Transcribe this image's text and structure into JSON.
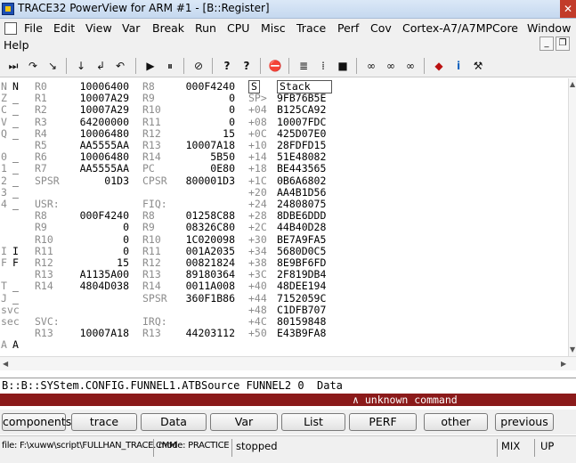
{
  "window": {
    "title": "TRACE32 PowerView for ARM #1 - [B::Register]",
    "close_glyph": "✕"
  },
  "menu": {
    "items": [
      "File",
      "Edit",
      "View",
      "Var",
      "Break",
      "Run",
      "CPU",
      "Misc",
      "Trace",
      "Perf",
      "Cov",
      "Cortex-A7/A7MPCore",
      "Window"
    ],
    "help": "Help",
    "mdi_minimize": "_",
    "mdi_restore": "❐"
  },
  "toolbar": {
    "icons": [
      "step-icon",
      "step-over-icon",
      "step-into-icon",
      "down-arrow-icon",
      "check-icon",
      "return-icon",
      "go-icon",
      "break-icon",
      "no-icon",
      "help-icon",
      "help-pointer-icon",
      "stop-icon",
      "list-icon",
      "memory-icon",
      "chip-icon",
      "glasses-icon",
      "glasses-icon-2",
      "glasses-icon-3",
      "target-icon",
      "info-icon",
      "wrench-icon"
    ],
    "glyphs": [
      "⏭",
      "↷",
      "↘",
      "↓",
      "↲",
      "↶",
      "▶",
      "⏸",
      "⊘",
      "?",
      "?",
      "⛔",
      "≣",
      "⁞",
      "■",
      "∞",
      "∞",
      "∞",
      "◆",
      "i",
      "⚒"
    ]
  },
  "registers": {
    "flags": [
      [
        "N",
        "N"
      ],
      [
        "Z",
        "_"
      ],
      [
        "C",
        "_"
      ],
      [
        "V",
        "_"
      ],
      [
        "Q",
        "_"
      ],
      [
        "",
        ""
      ],
      [
        "0",
        "_"
      ],
      [
        "1",
        "_"
      ],
      [
        "2",
        "_"
      ],
      [
        "3",
        "_"
      ],
      [
        "4",
        "_"
      ],
      [
        "",
        ""
      ],
      [
        "",
        ""
      ],
      [
        "",
        ""
      ],
      [
        "I",
        "I"
      ],
      [
        "F",
        "F"
      ],
      [
        "",
        ""
      ],
      [
        "T",
        "_"
      ],
      [
        "J",
        "_"
      ],
      [
        "svc",
        ""
      ],
      [
        "sec",
        ""
      ],
      [
        "",
        ""
      ],
      [
        "A",
        "A"
      ]
    ],
    "col1": [
      [
        "R0",
        "10006400"
      ],
      [
        "R1",
        "10007A29"
      ],
      [
        "R2",
        "10007A29"
      ],
      [
        "R3",
        "64200000"
      ],
      [
        "R4",
        "10006480"
      ],
      [
        "R5",
        "AA5555AA"
      ],
      [
        "R6",
        "10006480"
      ],
      [
        "R7",
        "AA5555AA"
      ],
      [
        "SPSR",
        "01D3"
      ],
      [
        "",
        ""
      ],
      [
        "USR:",
        ""
      ],
      [
        "R8",
        "000F4240"
      ],
      [
        "R9",
        "0"
      ],
      [
        "R10",
        "0"
      ],
      [
        "R11",
        "0"
      ],
      [
        "R12",
        "15"
      ],
      [
        "R13",
        "A1135A00"
      ],
      [
        "R14",
        "4804D038"
      ],
      [
        "",
        ""
      ],
      [
        "",
        ""
      ],
      [
        "SVC:",
        ""
      ],
      [
        "R13",
        "10007A18"
      ]
    ],
    "col2": [
      [
        "R8",
        "000F4240"
      ],
      [
        "R9",
        "0"
      ],
      [
        "R10",
        "0"
      ],
      [
        "R11",
        "0"
      ],
      [
        "R12",
        "15"
      ],
      [
        "R13",
        "10007A18"
      ],
      [
        "R14",
        "5B50"
      ],
      [
        "PC",
        "0E80"
      ],
      [
        "CPSR",
        "800001D3"
      ],
      [
        "",
        ""
      ],
      [
        "FIQ:",
        ""
      ],
      [
        "R8",
        "01258C88"
      ],
      [
        "R9",
        "08326C80"
      ],
      [
        "R10",
        "1C020098"
      ],
      [
        "R11",
        "001A2035"
      ],
      [
        "R12",
        "00821824"
      ],
      [
        "R13",
        "89180364"
      ],
      [
        "R14",
        "0011A008"
      ],
      [
        "SPSR",
        "360F1B86"
      ],
      [
        "",
        ""
      ],
      [
        "IRQ:",
        ""
      ],
      [
        "R13",
        "44203112"
      ]
    ]
  },
  "stack": {
    "s_label": "S",
    "header": "Stack",
    "offsets": [
      "SP>",
      "+04",
      "+08",
      "+0C",
      "+10",
      "+14",
      "+18",
      "+1C",
      "+20",
      "+24",
      "+28",
      "+2C",
      "+30",
      "+34",
      "+38",
      "+3C",
      "+40",
      "+44",
      "+48",
      "+4C",
      "+50"
    ],
    "values": [
      "9FB76B5E",
      "B125CA92",
      "10007FDC",
      "425D07E0",
      "28FDFD15",
      "51E48082",
      "BE443565",
      "0B6A6802",
      "AA4B1D56",
      "24808075",
      "8DBE6DDD",
      "44B40D28",
      "BE7A9FA5",
      "5680D0C5",
      "8E9BF6FD",
      "2F819DB4",
      "48DEE194",
      "7152059C",
      "C1DFB707",
      "80159848",
      "E43B9FA8"
    ]
  },
  "command": {
    "line": "B::B::SYStem.CONFIG.FUNNEL1.ATBSource FUNNEL2 0  Data",
    "error": "∧ unknown command"
  },
  "softkeys": [
    "components",
    "trace",
    "Data",
    "Var",
    "List",
    "PERF",
    "other",
    "previous"
  ],
  "status": {
    "file": "file: F:\\xuww\\script\\FULLHAN_TRACE.CMM",
    "mode": "mode: PRACTICE",
    "state": "stopped",
    "mix": "MIX",
    "up": "UP"
  },
  "colors": {
    "error_bg": "#8b1a1a",
    "title_bg": "#c5d8ef",
    "gray_label": "#8c8c8c"
  }
}
